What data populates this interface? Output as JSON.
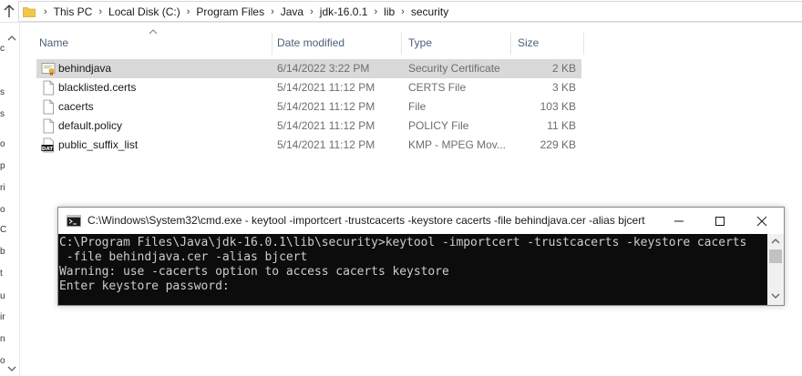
{
  "breadcrumb": [
    "This PC",
    "Local Disk (C:)",
    "Program Files",
    "Java",
    "jdk-16.0.1",
    "lib",
    "security"
  ],
  "columns": {
    "name": "Name",
    "date_modified": "Date modified",
    "type": "Type",
    "size": "Size"
  },
  "files": [
    {
      "name": "behindjava",
      "date": "6/14/2022 3:22 PM",
      "type": "Security Certificate",
      "size": "2 KB",
      "icon": "certificate-icon",
      "selected": true
    },
    {
      "name": "blacklisted.certs",
      "date": "5/14/2021 11:12 PM",
      "type": "CERTS File",
      "size": "3 KB",
      "icon": "file-icon",
      "selected": false
    },
    {
      "name": "cacerts",
      "date": "5/14/2021 11:12 PM",
      "type": "File",
      "size": "103 KB",
      "icon": "file-icon",
      "selected": false
    },
    {
      "name": "default.policy",
      "date": "5/14/2021 11:12 PM",
      "type": "POLICY File",
      "size": "11 KB",
      "icon": "file-icon",
      "selected": false
    },
    {
      "name": "public_suffix_list",
      "date": "5/14/2021 11:12 PM",
      "type": "KMP - MPEG Mov...",
      "size": "229 KB",
      "icon": "dat-file-icon",
      "selected": false
    }
  ],
  "nav_letters": [
    "c",
    "s",
    "s",
    "o",
    "p",
    "ri",
    "o",
    "C",
    "b",
    "t",
    "u",
    "ir",
    "n",
    "o"
  ],
  "cmd": {
    "title": "C:\\Windows\\System32\\cmd.exe - keytool  -importcert -trustcacerts -keystore cacerts -file behindjava.cer -alias bjcert",
    "lines": [
      "C:\\Program Files\\Java\\jdk-16.0.1\\lib\\security>keytool -importcert -trustcacerts -keystore cacerts",
      " -file behindjava.cer -alias bjcert",
      "Warning: use -cacerts option to access cacerts keystore",
      "Enter keystore password:"
    ]
  },
  "colors": {
    "selected_row": "#d9d9d9",
    "header_text": "#4c607a",
    "console_bg": "#0c0c0c",
    "console_text": "#cccccc"
  }
}
